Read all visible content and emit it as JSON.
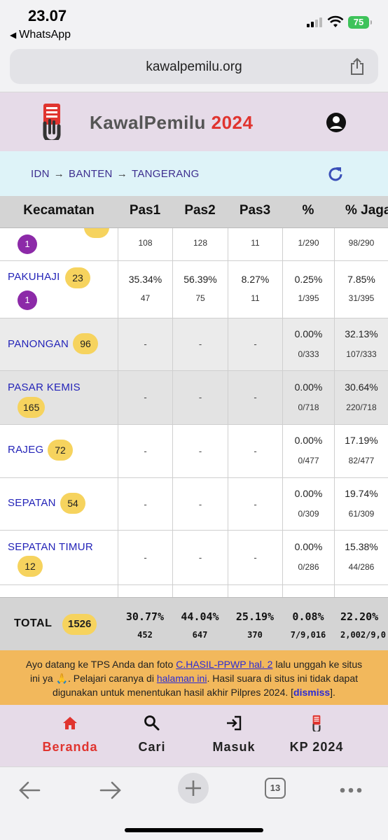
{
  "status_bar": {
    "time": "23.07",
    "back_app": "WhatsApp",
    "battery": "75"
  },
  "browser": {
    "url": "kawalpemilu.org",
    "tab_count": "13"
  },
  "header": {
    "brand": "KawalPemilu",
    "year": "2024"
  },
  "breadcrumb": [
    "IDN",
    "BANTEN",
    "TANGERANG"
  ],
  "table": {
    "headers": [
      "Kecamatan",
      "Pas1",
      "Pas2",
      "Pas3",
      "%",
      "% Jaga"
    ],
    "rows": [
      {
        "name": "",
        "badge": "",
        "purple_badge": "1",
        "pas1_pct": "",
        "pas1": "108",
        "pas2_pct": "",
        "pas2": "128",
        "pas3_pct": "",
        "pas3": "11",
        "pct": "",
        "pct_count": "1/290",
        "jaga": "",
        "jaga_count": "98/290"
      },
      {
        "name": "PAKUHAJI",
        "badge": "23",
        "purple_badge": "1",
        "pas1_pct": "35.34%",
        "pas1": "47",
        "pas2_pct": "56.39%",
        "pas2": "75",
        "pas3_pct": "8.27%",
        "pas3": "11",
        "pct": "0.25%",
        "pct_count": "1/395",
        "jaga": "7.85%",
        "jaga_count": "31/395"
      },
      {
        "name": "PANONGAN",
        "badge": "96",
        "pas1": "-",
        "pas2": "-",
        "pas3": "-",
        "pct": "0.00%",
        "pct_count": "0/333",
        "jaga": "32.13%",
        "jaga_count": "107/333"
      },
      {
        "name": "PASAR KEMIS",
        "badge": "165",
        "pas1": "-",
        "pas2": "-",
        "pas3": "-",
        "pct": "0.00%",
        "pct_count": "0/718",
        "jaga": "30.64%",
        "jaga_count": "220/718"
      },
      {
        "name": "RAJEG",
        "badge": "72",
        "pas1": "-",
        "pas2": "-",
        "pas3": "-",
        "pct": "0.00%",
        "pct_count": "0/477",
        "jaga": "17.19%",
        "jaga_count": "82/477"
      },
      {
        "name": "SEPATAN",
        "badge": "54",
        "pas1": "-",
        "pas2": "-",
        "pas3": "-",
        "pct": "0.00%",
        "pct_count": "0/309",
        "jaga": "19.74%",
        "jaga_count": "61/309"
      },
      {
        "name": "SEPATAN TIMUR",
        "badge": "12",
        "pas1": "-",
        "pas2": "-",
        "pas3": "-",
        "pct": "0.00%",
        "pct_count": "0/286",
        "jaga": "15.38%",
        "jaga_count": "44/286"
      }
    ],
    "total": {
      "label": "TOTAL",
      "badge": "1526",
      "pas1_pct": "30.77%",
      "pas1": "452",
      "pas2_pct": "44.04%",
      "pas2": "647",
      "pas3_pct": "25.19%",
      "pas3": "370",
      "pct": "0.08%",
      "pct_count": "7/9,016",
      "jaga": "22.20%",
      "jaga_count": "2,002/9,0"
    }
  },
  "notice": {
    "t1": "Ayo datang ke TPS Anda dan foto ",
    "link1": "C.HASIL-PPWP hal. 2",
    "t2": " lalu unggah ke situs ini ya 🙏. Pelajari caranya di ",
    "link2": "halaman ini",
    "t3": ". Hasil suara di situs ini tidak dapat digunakan untuk menentukan hasil akhir Pilpres 2024. [",
    "dismiss": "dismiss",
    "t4": "]."
  },
  "bottom_nav": [
    "Beranda",
    "Cari",
    "Masuk",
    "KP 2024"
  ],
  "colors": {
    "accent_red": "#e0342f",
    "badge_yellow": "#f6d35e",
    "badge_purple": "#8c2aa8",
    "link_blue": "#2323b8"
  }
}
